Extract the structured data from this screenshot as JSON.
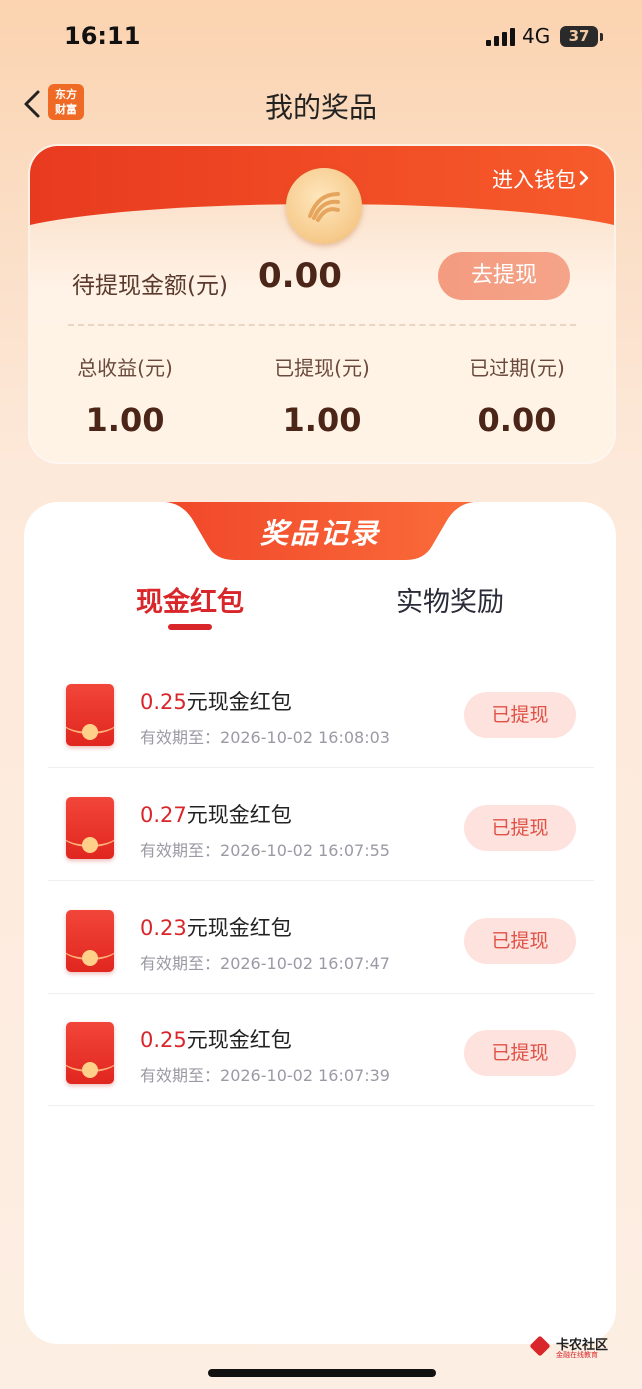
{
  "status_bar": {
    "time": "16:11",
    "network": "4G",
    "battery": "37"
  },
  "nav": {
    "title": "我的奖品",
    "brand_logo": "东方财富"
  },
  "wallet": {
    "link_label": "进入钱包",
    "pending_label": "待提现金额(元)",
    "pending_value": "0.00",
    "withdraw_label": "去提现",
    "stats": [
      {
        "label": "总收益(元)",
        "value": "1.00"
      },
      {
        "label": "已提现(元)",
        "value": "1.00"
      },
      {
        "label": "已过期(元)",
        "value": "0.00"
      }
    ]
  },
  "records": {
    "title": "奖品记录",
    "tabs": [
      {
        "label": "现金红包",
        "active": true
      },
      {
        "label": "实物奖励",
        "active": false
      }
    ],
    "items": [
      {
        "amount": "0.25",
        "suffix": "元现金红包",
        "expiry_label": "有效期至：",
        "expiry": "2026-10-02 16:08:03",
        "status": "已提现"
      },
      {
        "amount": "0.27",
        "suffix": "元现金红包",
        "expiry_label": "有效期至：",
        "expiry": "2026-10-02 16:07:55",
        "status": "已提现"
      },
      {
        "amount": "0.23",
        "suffix": "元现金红包",
        "expiry_label": "有效期至：",
        "expiry": "2026-10-02 16:07:47",
        "status": "已提现"
      },
      {
        "amount": "0.25",
        "suffix": "元现金红包",
        "expiry_label": "有效期至：",
        "expiry": "2026-10-02 16:07:39",
        "status": "已提现"
      }
    ]
  },
  "watermark": {
    "name": "卡农社区",
    "tagline": "金融在线教育"
  },
  "colors": {
    "accent": "#d8262a",
    "header_red": "#e83a1f",
    "pill_bg": "#fde2de"
  }
}
